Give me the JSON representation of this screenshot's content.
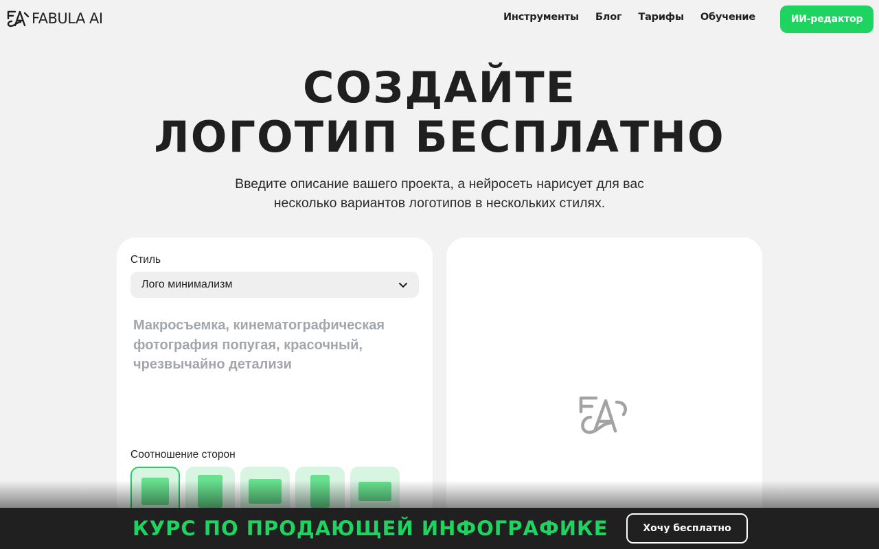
{
  "header": {
    "brand": "FABULA AI",
    "nav": [
      "Инструменты",
      "Блог",
      "Тарифы",
      "Обучение"
    ],
    "cta": "ИИ-редактор"
  },
  "hero": {
    "title_line1": "СОЗДАЙТЕ",
    "title_line2": "ЛОГОТИП БЕСПЛАТНО",
    "subtitle_line1": "Введите описание вашего проекта, а нейросеть нарисует для вас",
    "subtitle_line2": "несколько вариантов логотипов в нескольких стилях."
  },
  "form": {
    "style_label": "Стиль",
    "style_value": "Лого минимализм",
    "prompt_value": "",
    "prompt_placeholder": "Макросъемка, кинематографическая фотография попугая, красочный, чрезвычайно детализи",
    "ratio_label": "Соотношение сторон",
    "ratios_selected_index": 0
  },
  "preview": {
    "placeholder_icon": "fabula-logo-icon"
  },
  "banner": {
    "text": "КУРС ПО ПРОДАЮЩЕЙ ИНФОГРАФИКЕ",
    "button": "Хочу бесплатно"
  },
  "colors": {
    "accent": "#1ed35f",
    "background": "#f2f2f2",
    "banner_bg": "#202020",
    "ratio_bg": "#d8f5e2",
    "ratio_fill": "#67e08f"
  }
}
